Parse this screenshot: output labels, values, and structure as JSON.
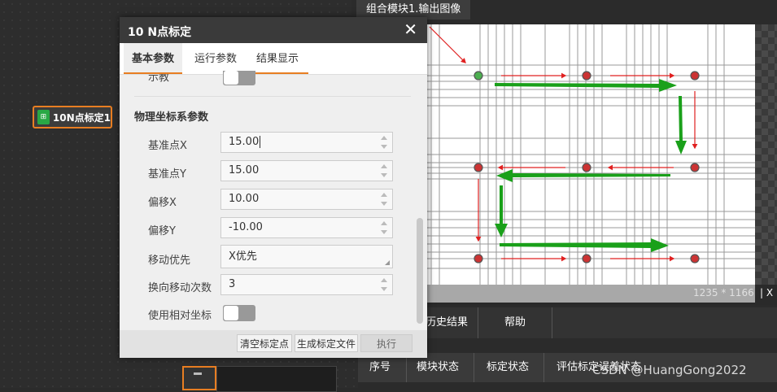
{
  "canvas": {
    "node_label": "10N点标定1"
  },
  "image_view": {
    "tab_label": "组合模块1.输出图像",
    "size_text": "1235 * 1166",
    "x_label": "| X"
  },
  "results": {
    "tabs": [
      "历史结果",
      "帮助"
    ],
    "columns": [
      "序号",
      "模块状态",
      "标定状态",
      "评估标定误差状态"
    ]
  },
  "watermark": "CSDN @HuangGong2022",
  "dialog": {
    "title": "10 N点标定",
    "close": "✕",
    "tabs": [
      "基本参数",
      "运行参数",
      "结果显示"
    ],
    "partial_label": "示教",
    "section_title": "物理坐标系参数",
    "fields": [
      {
        "label": "基准点X",
        "value": "15.00"
      },
      {
        "label": "基准点Y",
        "value": "15.00"
      },
      {
        "label": "偏移X",
        "value": "10.00"
      },
      {
        "label": "偏移Y",
        "value": "-10.00"
      },
      {
        "label": "移动优先",
        "value": "X优先"
      },
      {
        "label": "换向移动次数",
        "value": "3"
      }
    ],
    "relative_label": "使用相对坐标",
    "buttons": {
      "clear": "清空标定点",
      "generate": "生成标定文件",
      "execute": "执行"
    }
  },
  "colors": {
    "accent": "#e87e22",
    "title_bar": "#3a3a3a",
    "arrow_green": "#1aa01a",
    "arrow_red": "#e02020",
    "point_red": "#cc3333"
  }
}
